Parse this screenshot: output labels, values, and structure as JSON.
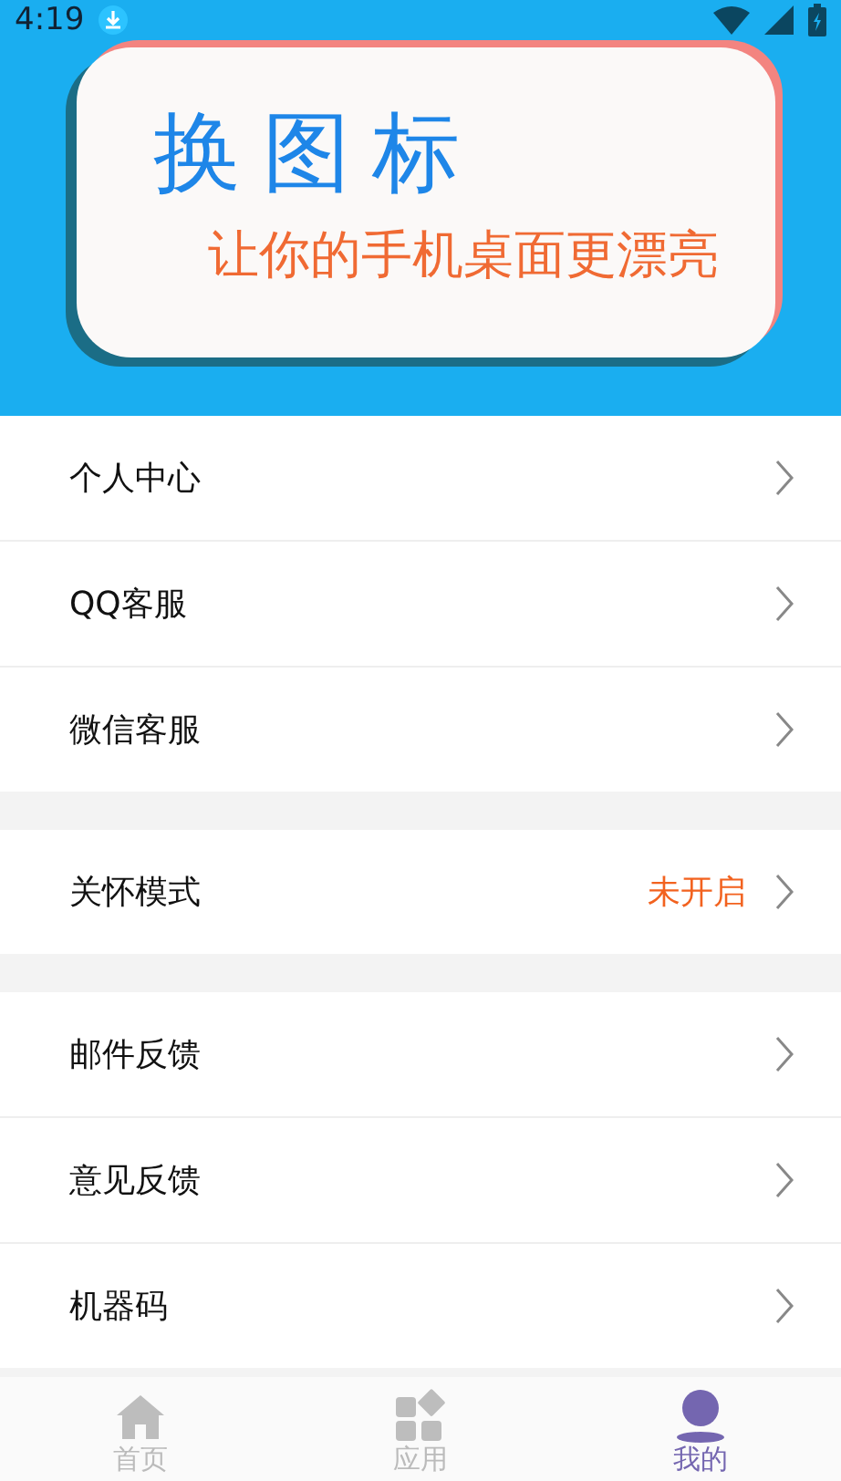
{
  "status_bar": {
    "time": "4:19"
  },
  "banner": {
    "title": "换图标",
    "subtitle": "让你的手机桌面更漂亮"
  },
  "sections": [
    {
      "items": [
        {
          "label": "个人中心"
        },
        {
          "label": "QQ客服"
        },
        {
          "label": "微信客服"
        }
      ]
    },
    {
      "items": [
        {
          "label": "关怀模式",
          "value": "未开启"
        }
      ]
    },
    {
      "items": [
        {
          "label": "邮件反馈"
        },
        {
          "label": "意见反馈"
        },
        {
          "label": "机器码"
        }
      ]
    }
  ],
  "tab_bar": [
    {
      "label": "首页",
      "kind": "home",
      "selected": false
    },
    {
      "label": "应用",
      "kind": "apps",
      "selected": false
    },
    {
      "label": "我的",
      "kind": "profile",
      "selected": true
    }
  ]
}
